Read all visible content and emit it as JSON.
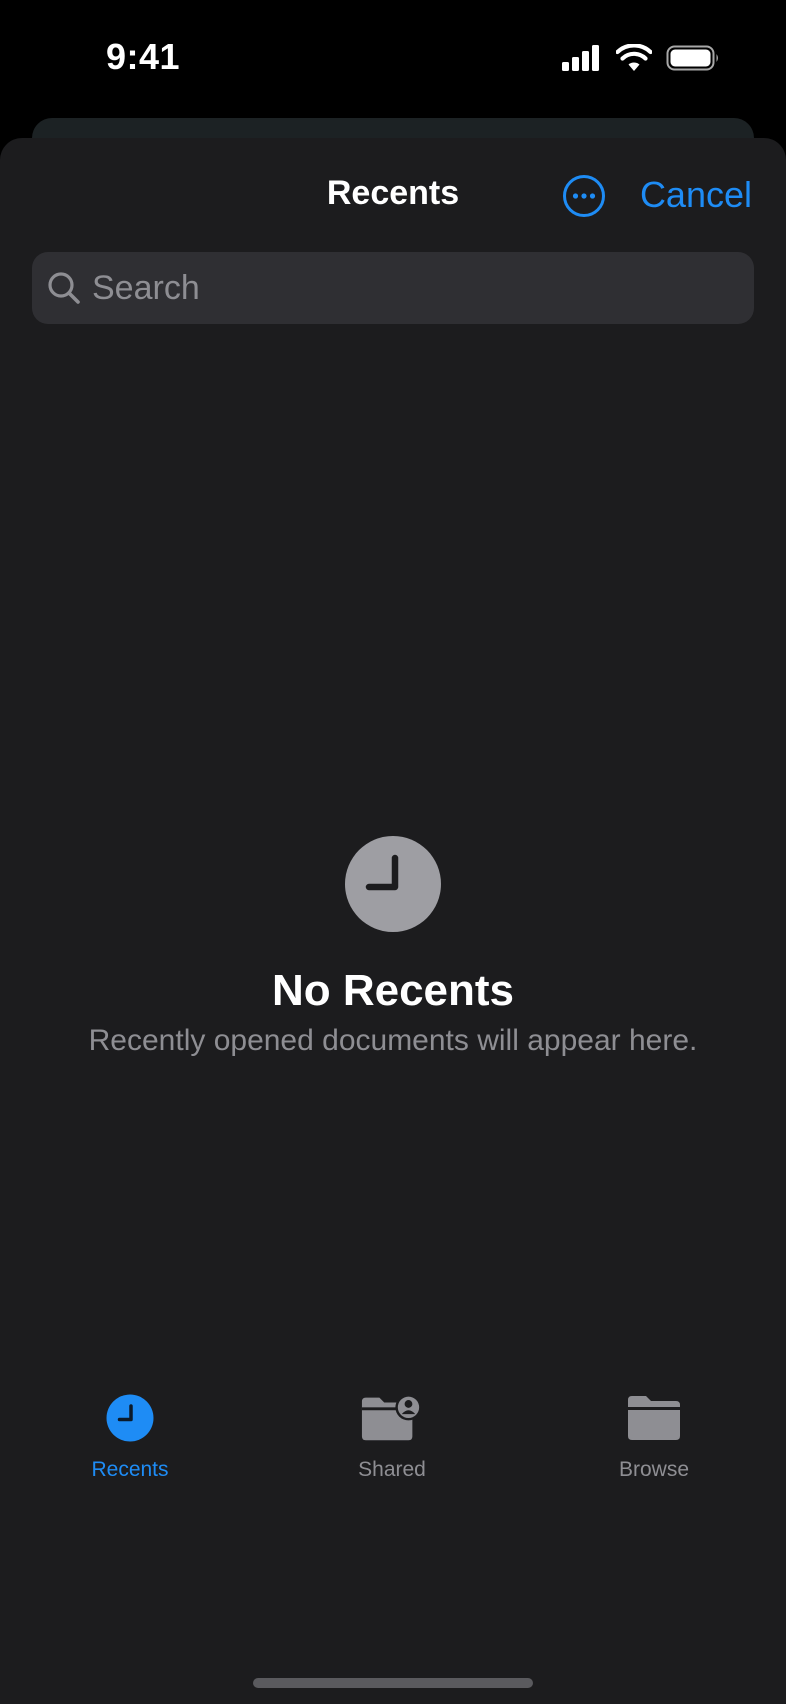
{
  "status_bar": {
    "time": "9:41"
  },
  "header": {
    "title": "Recents",
    "cancel_label": "Cancel"
  },
  "search": {
    "placeholder": "Search"
  },
  "empty_state": {
    "title": "No Recents",
    "subtitle": "Recently opened documents will appear here."
  },
  "tabs": [
    {
      "label": "Recents",
      "icon": "clock-icon",
      "active": true
    },
    {
      "label": "Shared",
      "icon": "shared-folder-icon",
      "active": false
    },
    {
      "label": "Browse",
      "icon": "folder-icon",
      "active": false
    }
  ],
  "colors": {
    "accent": "#1e8cf5",
    "background": "#1c1c1e",
    "search_field": "#2f2f33",
    "secondary_text": "#8e8e93"
  }
}
